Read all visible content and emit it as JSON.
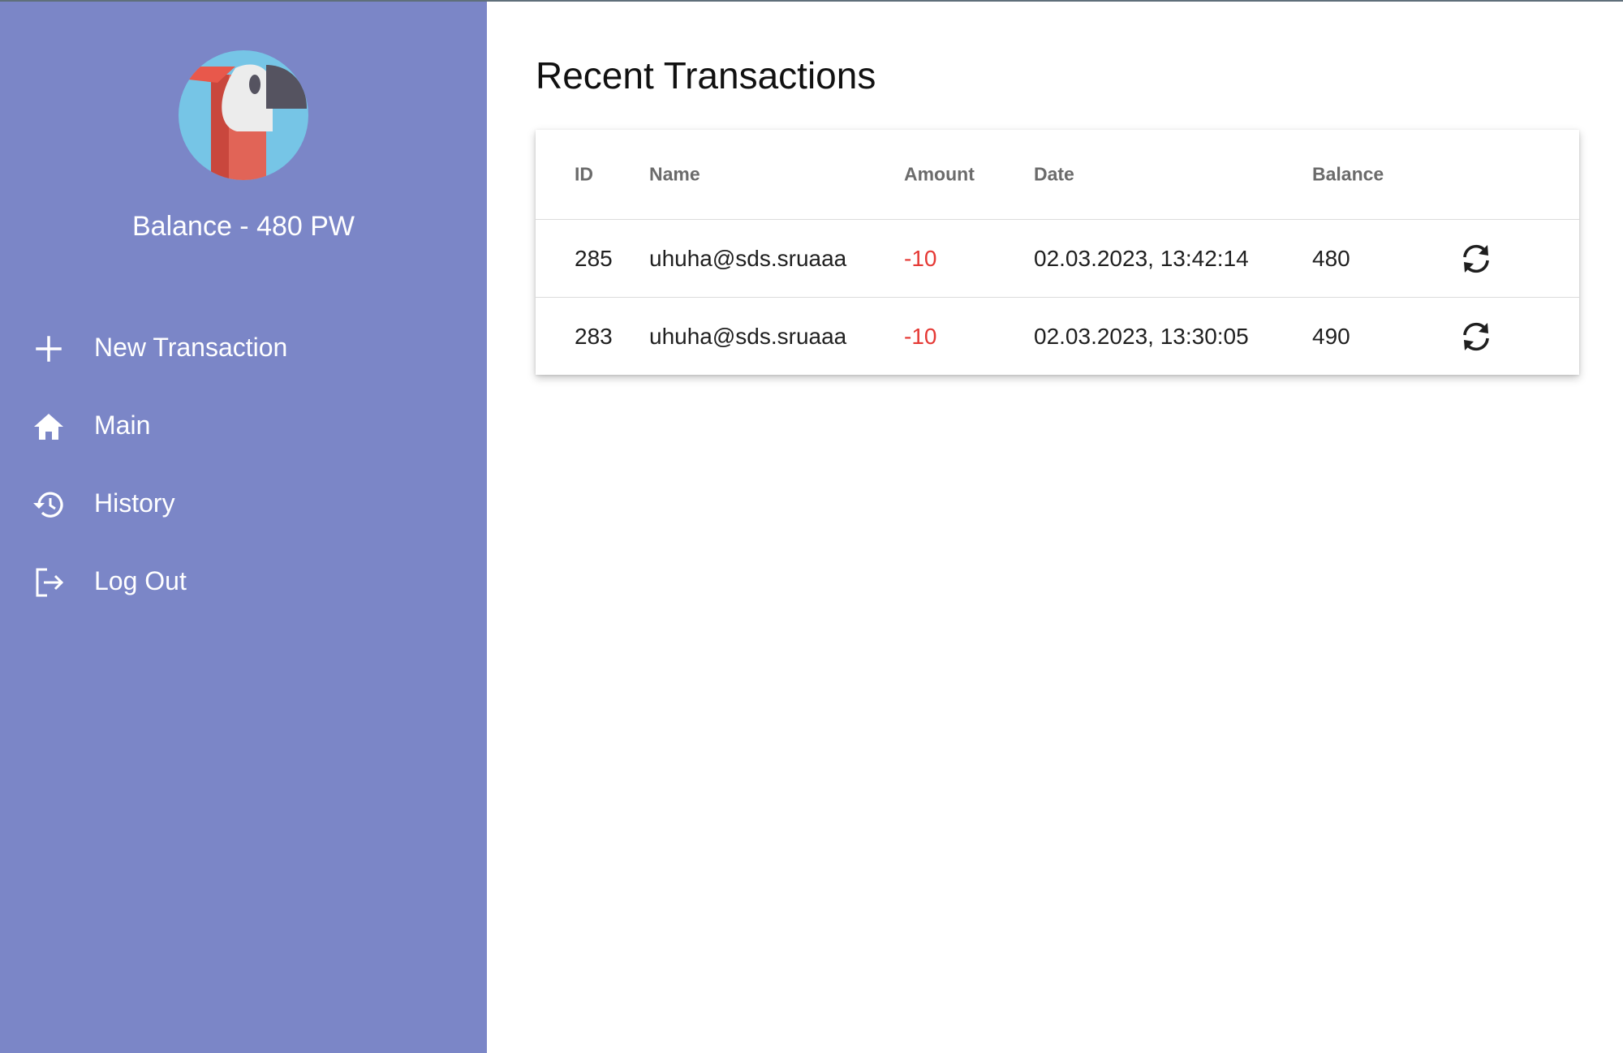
{
  "sidebar": {
    "balance_text": "Balance - 480 PW",
    "logo_icon": "parrot-logo-icon",
    "items": [
      {
        "label": "New Transaction",
        "icon": "plus-icon"
      },
      {
        "label": "Main",
        "icon": "home-icon"
      },
      {
        "label": "History",
        "icon": "history-icon"
      },
      {
        "label": "Log Out",
        "icon": "logout-icon"
      }
    ],
    "background_color": "#7b86c7"
  },
  "main": {
    "title": "Recent Transactions",
    "table": {
      "columns": [
        "ID",
        "Name",
        "Amount",
        "Date",
        "Balance"
      ],
      "rows": [
        {
          "id": "285",
          "name": "uhuha@sds.sruaaa",
          "amount": "-10",
          "date": "02.03.2023, 13:42:14",
          "balance": "480",
          "action_icon": "repeat-icon"
        },
        {
          "id": "283",
          "name": "uhuha@sds.sruaaa",
          "amount": "-10",
          "date": "02.03.2023, 13:30:05",
          "balance": "490",
          "action_icon": "repeat-icon"
        }
      ],
      "negative_amount_color": "#e53935"
    }
  }
}
